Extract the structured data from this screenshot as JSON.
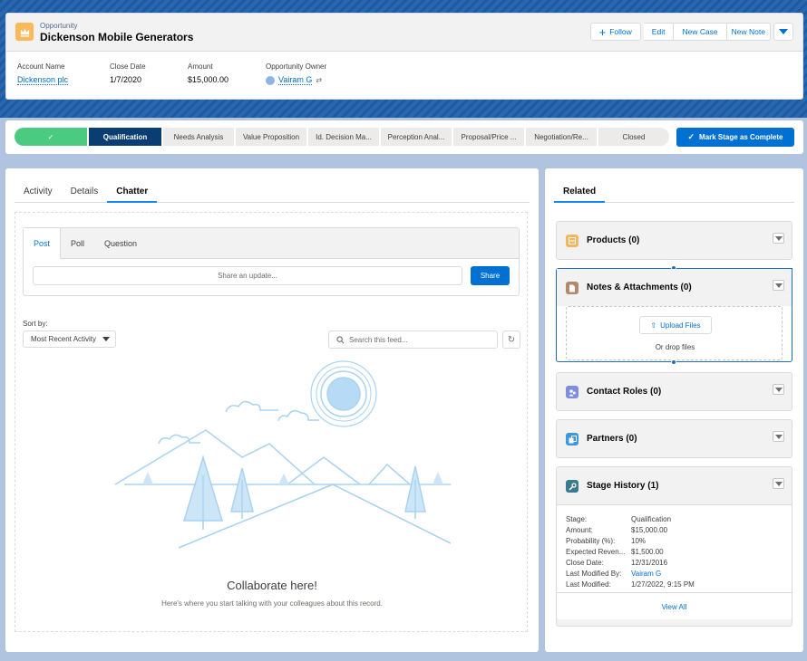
{
  "header": {
    "object_type": "Opportunity",
    "record_name": "Dickenson Mobile Generators",
    "buttons": {
      "follow": "Follow",
      "edit": "Edit",
      "new_case": "New Case",
      "new_note": "New Note"
    },
    "highlights": [
      {
        "label": "Account Name",
        "value": "Dickenson plc"
      },
      {
        "label": "Close Date",
        "value": "1/7/2020"
      },
      {
        "label": "Amount",
        "value": "$15,000.00"
      },
      {
        "label": "Opportunity Owner",
        "value": "Vairam G"
      }
    ]
  },
  "path": {
    "stages": [
      "",
      "Qualification",
      "Needs Analysis",
      "Value Proposition",
      "Id. Decision Ma...",
      "Perception Anal...",
      "Proposal/Price ...",
      "Negotiation/Re...",
      "Closed"
    ],
    "complete_check": "✓",
    "mark_button": "Mark Stage as Complete"
  },
  "main": {
    "tabs": [
      "Activity",
      "Details",
      "Chatter"
    ],
    "active_tab": "Chatter",
    "publisher": {
      "tabs": [
        "Post",
        "Poll",
        "Question"
      ],
      "placeholder": "Share an update...",
      "share_label": "Share"
    },
    "sort_label": "Sort by:",
    "sort_value": "Most Recent Activity",
    "search_placeholder": "Search this feed...",
    "empty_title": "Collaborate here!",
    "empty_subtitle": "Here's where you start talking with your colleagues about this record."
  },
  "related": {
    "tab": "Related",
    "cards": {
      "products": "Products (0)",
      "notes": "Notes & Attachments (0)",
      "contact_roles": "Contact Roles (0)",
      "partners": "Partners (0)",
      "stage_history": "Stage History (1)"
    },
    "upload_label": "Upload Files",
    "drop_text": "Or drop files",
    "stage_history_fields": [
      {
        "k": "Stage:",
        "v": "Qualification"
      },
      {
        "k": "Amount:",
        "v": "$15,000.00"
      },
      {
        "k": "Probability (%):",
        "v": "10%"
      },
      {
        "k": "Expected Reven...",
        "v": "$1,500.00"
      },
      {
        "k": "Close Date:",
        "v": "12/31/2016"
      },
      {
        "k": "Last Modified By:",
        "v": "Vairam G"
      },
      {
        "k": "Last Modified:",
        "v": "1/27/2022, 9:15 PM"
      }
    ],
    "view_all": "View All"
  },
  "colors": {
    "brand": "#0070d2",
    "path_complete": "#4bca81",
    "path_current": "#0a3d73",
    "opportunity_icon": "#fcb95b"
  }
}
